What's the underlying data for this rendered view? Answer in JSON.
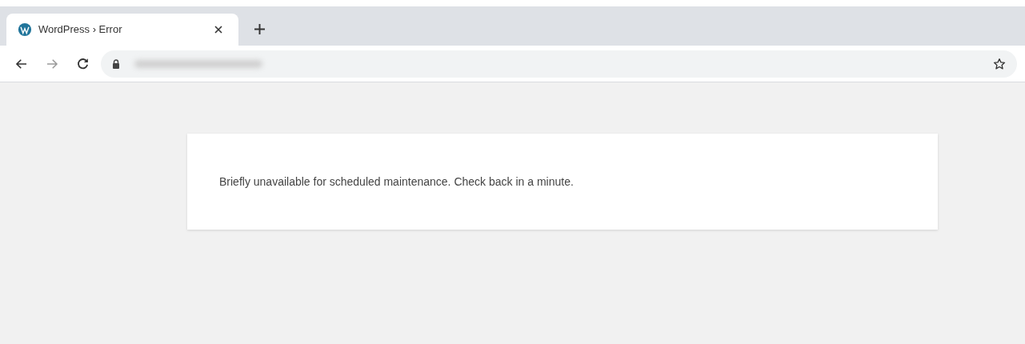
{
  "tabs": [
    {
      "title": "WordPress › Error",
      "selected": true
    }
  ],
  "page": {
    "message": "Briefly unavailable for scheduled maintenance. Check back in a minute."
  }
}
